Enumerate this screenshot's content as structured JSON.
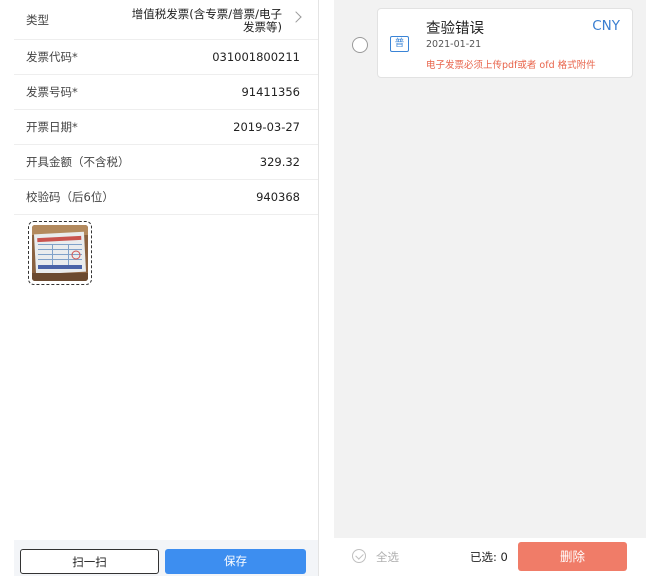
{
  "invoice_form": {
    "fields": [
      {
        "label": "类型",
        "value": "增值税发票(含专票/普票/电子发票等)"
      },
      {
        "label": "发票代码*",
        "value": "031001800211"
      },
      {
        "label": "发票号码*",
        "value": "91411356"
      },
      {
        "label": "开票日期*",
        "value": "2019-03-27"
      },
      {
        "label": "开具金额（不含税）",
        "value": "329.32"
      },
      {
        "label": "校验码（后6位）",
        "value": "940368"
      }
    ],
    "scan_label": "扫一扫",
    "save_label": "保存",
    "accent_color": "#3d8ef0"
  },
  "invoice_list": {
    "items": [
      {
        "badge": "普",
        "title": "查验错误",
        "currency": "CNY",
        "date": "2021-01-21",
        "warning": "电子发票必须上传pdf或者 ofd 格式附件"
      }
    ],
    "footer": {
      "select_all_label": "全选",
      "selected_label": "已选: 0",
      "delete_label": "删除",
      "delete_color": "#f07c68"
    }
  }
}
